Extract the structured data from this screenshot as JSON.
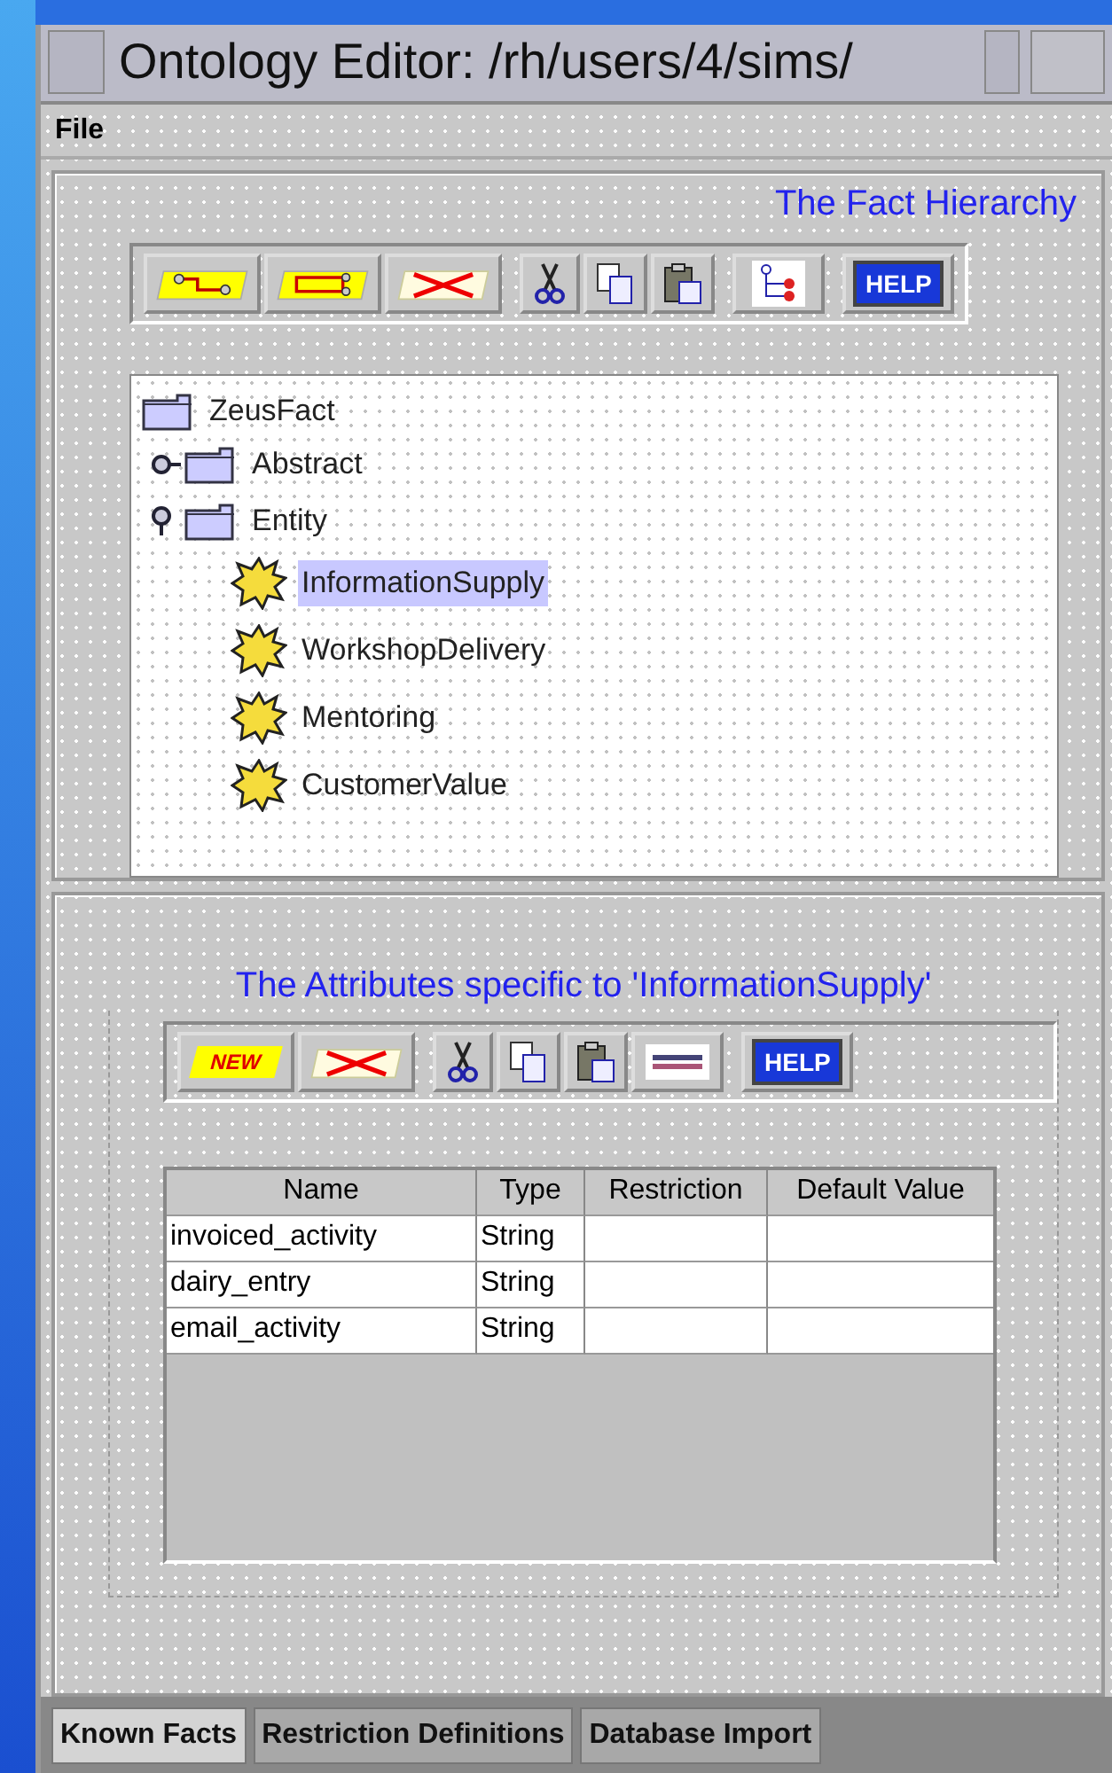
{
  "window": {
    "title": "Ontology Editor: /rh/users/4/sims/"
  },
  "menu": [
    "File"
  ],
  "fact_hierarchy": {
    "title": "The Fact Hierarchy",
    "toolbar": [
      [
        {
          "kind": "link"
        },
        {
          "kind": "rect"
        },
        {
          "kind": "delete"
        }
      ],
      [
        {
          "kind": "cut"
        },
        {
          "kind": "copy"
        },
        {
          "kind": "paste"
        }
      ],
      [
        {
          "kind": "tree"
        }
      ],
      [
        {
          "kind": "help",
          "label": "HELP"
        }
      ]
    ],
    "tree": [
      {
        "label": "ZeusFact",
        "kind": "folder",
        "selected": false,
        "children": [
          {
            "label": "Abstract",
            "kind": "folder",
            "selected": false,
            "expanded": false
          },
          {
            "label": "Entity",
            "kind": "folder",
            "selected": false,
            "expanded": true,
            "children": [
              {
                "label": "InformationSupply",
                "kind": "fact",
                "selected": true
              },
              {
                "label": "WorkshopDelivery",
                "kind": "fact",
                "selected": false
              },
              {
                "label": "Mentoring",
                "kind": "fact",
                "selected": false
              },
              {
                "label": "CustomerValue",
                "kind": "fact",
                "selected": false
              }
            ]
          }
        ]
      }
    ]
  },
  "attributes": {
    "title": "The Attributes specific to 'InformationSupply'",
    "toolbar": [
      [
        {
          "kind": "new",
          "label": "NEW"
        },
        {
          "kind": "delete"
        }
      ],
      [
        {
          "kind": "cut"
        },
        {
          "kind": "copy"
        },
        {
          "kind": "paste"
        },
        {
          "kind": "row"
        }
      ],
      [
        {
          "kind": "help",
          "label": "HELP"
        }
      ]
    ],
    "table": {
      "columns": [
        "Name",
        "Type",
        "Restriction",
        "Default Value"
      ],
      "rows": [
        [
          "invoiced_activity",
          "String",
          "",
          ""
        ],
        [
          "dairy_entry",
          "String",
          "",
          ""
        ],
        [
          "email_activity",
          "String",
          "",
          ""
        ]
      ]
    }
  },
  "tabs": [
    {
      "label": "Known Facts",
      "selected": true
    },
    {
      "label": "Restriction Definitions",
      "selected": false
    },
    {
      "label": "Database Import",
      "selected": false
    }
  ]
}
